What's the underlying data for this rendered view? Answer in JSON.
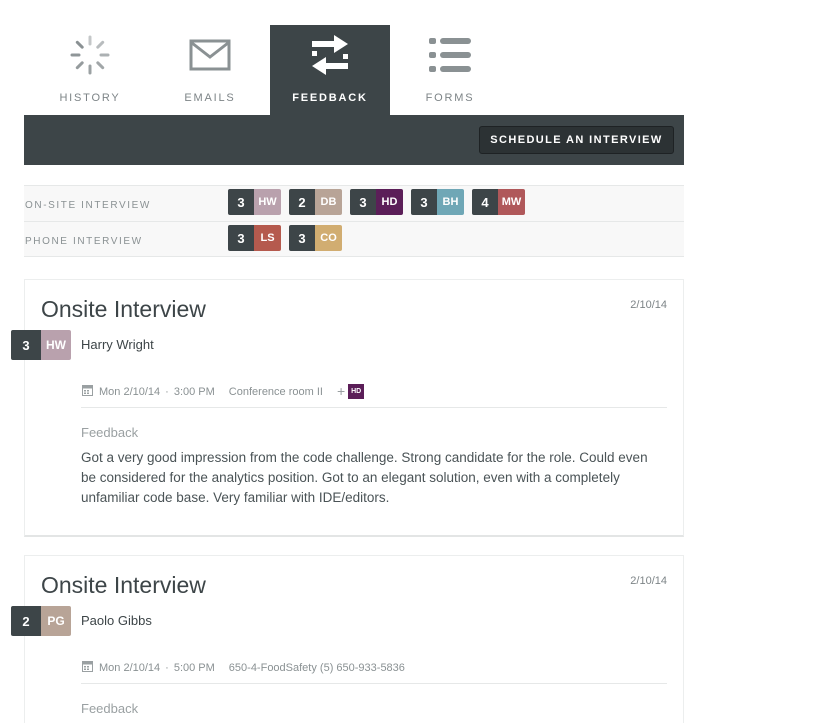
{
  "tabs": [
    {
      "label": "HISTORY",
      "icon": "loading-spinner-icon",
      "active": false
    },
    {
      "label": "EMAILS",
      "icon": "envelope-icon",
      "active": false
    },
    {
      "label": "FEEDBACK",
      "icon": "swap-arrows-icon",
      "active": true
    },
    {
      "label": "FORMS",
      "icon": "list-icon",
      "active": false
    }
  ],
  "toolbar": {
    "schedule_label": "SCHEDULE AN INTERVIEW"
  },
  "summary": {
    "rows": [
      {
        "label": "ON-SITE INTERVIEW",
        "badges": [
          {
            "num": "3",
            "initials": "HW",
            "color": "#b9a1ad"
          },
          {
            "num": "2",
            "initials": "DB",
            "color": "#b8a497"
          },
          {
            "num": "3",
            "initials": "HD",
            "color": "#5b1e58"
          },
          {
            "num": "3",
            "initials": "BH",
            "color": "#6fa7b6"
          },
          {
            "num": "4",
            "initials": "MW",
            "color": "#b0585a"
          }
        ]
      },
      {
        "label": "PHONE INTERVIEW",
        "badges": [
          {
            "num": "3",
            "initials": "LS",
            "color": "#b55a4e"
          },
          {
            "num": "3",
            "initials": "CO",
            "color": "#d1ad71"
          }
        ]
      }
    ]
  },
  "cards": [
    {
      "title": "Onsite Interview",
      "date": "2/10/14",
      "score": "3",
      "initials": "HW",
      "color": "#b9a1ad",
      "name": "Harry Wright",
      "datetime": "Mon 2/10/14",
      "time": "3:00 PM",
      "location": "Conference room II",
      "extra_initials": "HD",
      "feedback_label": "Feedback",
      "feedback": "Got a very good impression from the code challenge. Strong candidate for the role. Could even be considered for the analytics position. Got to an elegant solution, even with a completely unfamiliar code base. Very familiar with IDE/editors."
    },
    {
      "title": "Onsite Interview",
      "date": "2/10/14",
      "score": "2",
      "initials": "PG",
      "color": "#b8a497",
      "name": "Paolo Gibbs",
      "datetime": "Mon 2/10/14",
      "time": "5:00 PM",
      "location": "650-4-FoodSafety (5) 650-933-5836",
      "feedback_label": "Feedback"
    }
  ],
  "colors": {
    "dark": "#3d4548",
    "muted": "#8a9193"
  }
}
